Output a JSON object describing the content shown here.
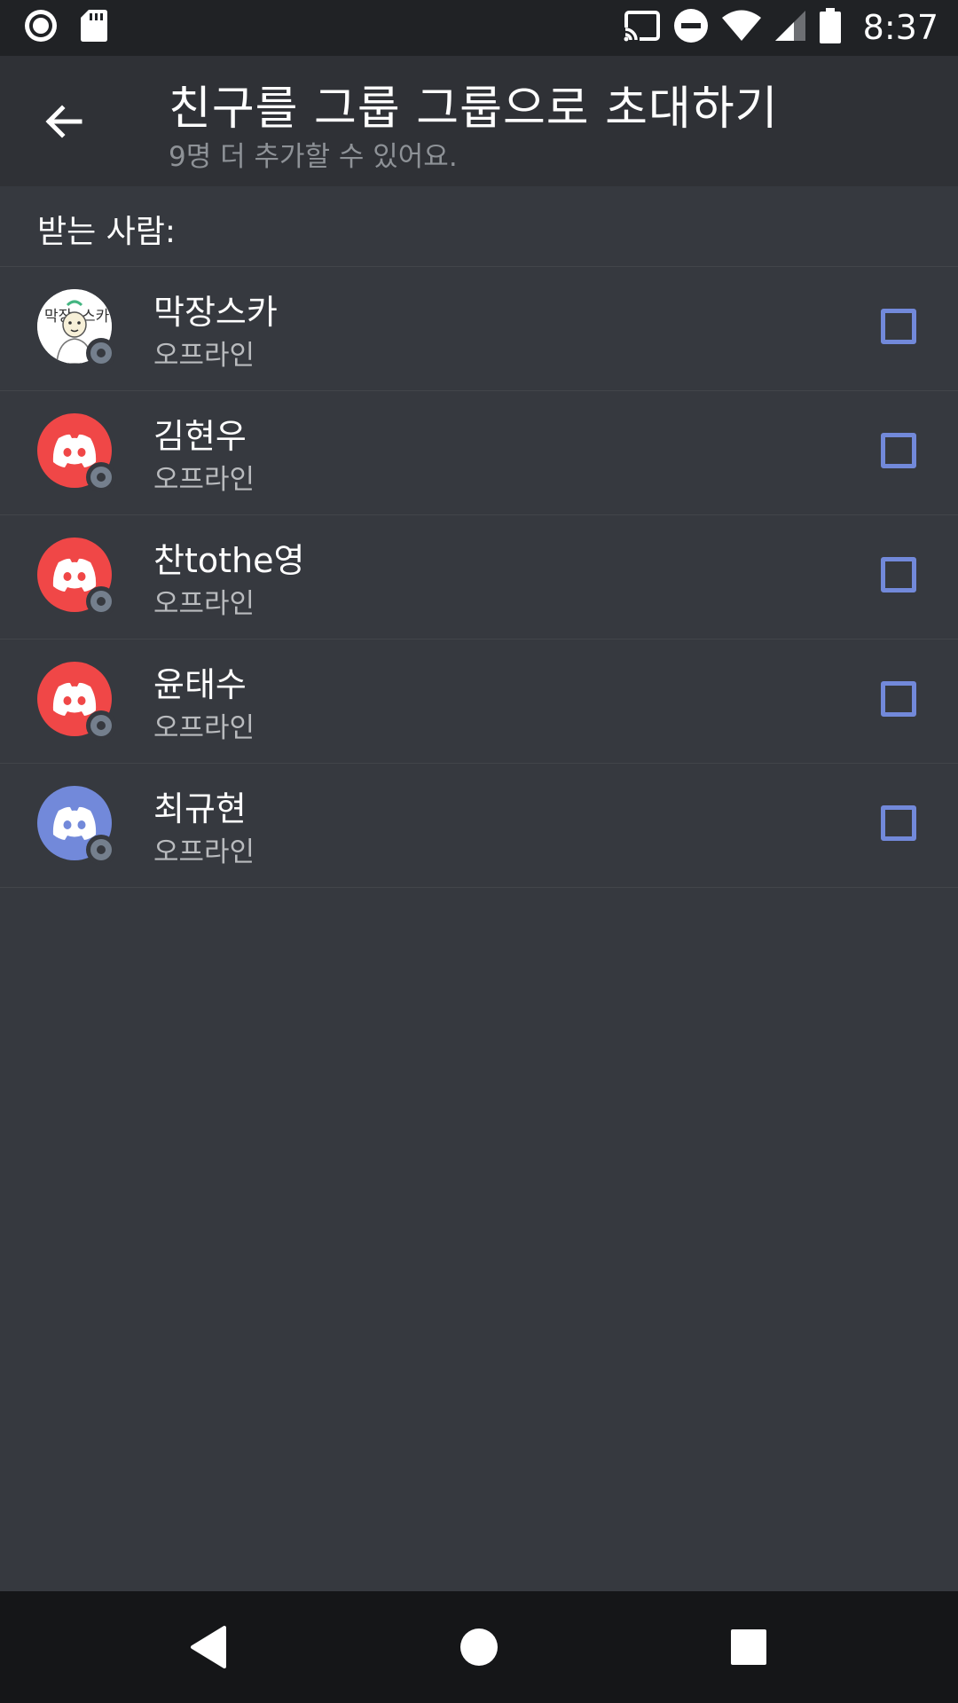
{
  "status_bar": {
    "time": "8:37",
    "left_icons": [
      "record-icon",
      "sd-card-icon"
    ],
    "right_icons": [
      "cast-icon",
      "do-not-disturb-icon",
      "wifi-icon",
      "cellular-signal-icon",
      "battery-icon"
    ]
  },
  "header": {
    "title": "친구를 그룹 그룹으로 초대하기",
    "subtitle": "9명 더 추가할 수 있어요."
  },
  "section": {
    "label": "받는 사람:"
  },
  "friends": [
    {
      "name": "막장스카",
      "status": "오프라인",
      "avatar": "custom-image",
      "checked": false
    },
    {
      "name": "김현우",
      "status": "오프라인",
      "avatar": "discord-red",
      "checked": false
    },
    {
      "name": "찬tothe영",
      "status": "오프라인",
      "avatar": "discord-red",
      "checked": false
    },
    {
      "name": "윤태수",
      "status": "오프라인",
      "avatar": "discord-red",
      "checked": false
    },
    {
      "name": "최규현",
      "status": "오프라인",
      "avatar": "discord-blurple",
      "checked": false
    }
  ],
  "colors": {
    "background": "#36393f",
    "header": "#2f3136",
    "status_bar": "#202225",
    "nav_bar": "#151618",
    "accent": "#7289da",
    "avatar_red": "#f04747",
    "avatar_blurple": "#7289da",
    "offline": "#747f8d"
  },
  "nav": {
    "icons": [
      "nav-back-icon",
      "nav-home-icon",
      "nav-recents-icon"
    ]
  }
}
